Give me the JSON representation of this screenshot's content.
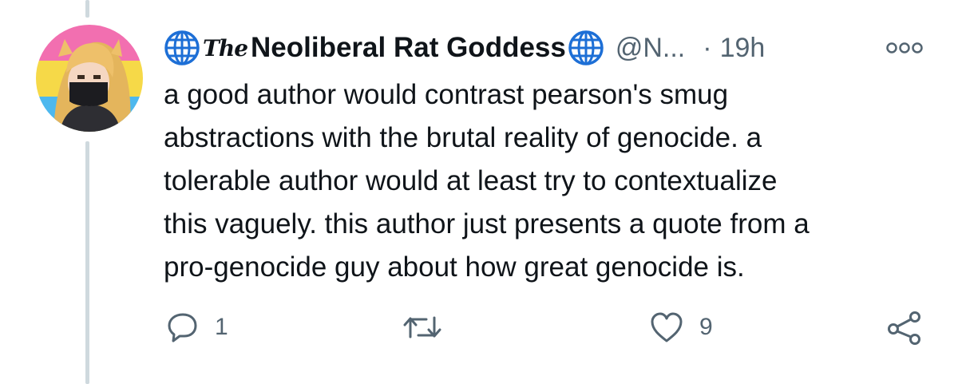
{
  "tweet": {
    "author": {
      "name_prefix": "The",
      "name": "Neoliberal Rat Goddess",
      "handle": "@N...",
      "avatar_icon": "avatar-image",
      "badge_icon": "globe-icon"
    },
    "separator": "·",
    "timestamp": "19h",
    "more_icon": "more-icon",
    "text": "a good author would contrast pearson's smug\nabstractions with the brutal reality of genocide. a\ntolerable author would at least try to contextualize\nthis vaguely. this author just presents a quote from a\npro-genocide guy about how great genocide is.",
    "actions": {
      "reply": {
        "icon": "reply-icon",
        "count": "1"
      },
      "retweet": {
        "icon": "retweet-icon",
        "count": ""
      },
      "like": {
        "icon": "heart-icon",
        "count": "9"
      },
      "share": {
        "icon": "share-icon"
      }
    }
  },
  "colors": {
    "text": "#0f1419",
    "secondary": "#536471",
    "thread_line": "#cfd9de",
    "globe_blue": "#1d6fd6"
  }
}
